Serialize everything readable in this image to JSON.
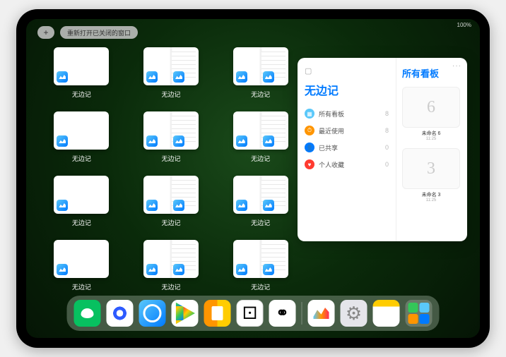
{
  "status": {
    "text": "100%"
  },
  "topbar": {
    "plus": "+",
    "reopen_label": "重新打开已关闭的窗口"
  },
  "thumbs": [
    {
      "label": "无边记",
      "split": false
    },
    {
      "label": "无边记",
      "split": true
    },
    {
      "label": "无边记",
      "split": true
    },
    {
      "label": "无边记",
      "split": false
    },
    {
      "label": "无边记",
      "split": true
    },
    {
      "label": "无边记",
      "split": true
    },
    {
      "label": "无边记",
      "split": false
    },
    {
      "label": "无边记",
      "split": true
    },
    {
      "label": "无边记",
      "split": true
    },
    {
      "label": "无边记",
      "split": false
    },
    {
      "label": "无边记",
      "split": true
    },
    {
      "label": "无边记",
      "split": true
    }
  ],
  "panel": {
    "title": "无边记",
    "right_title": "所有看板",
    "more": "···",
    "items": [
      {
        "icon": "grid",
        "color": "#5ac8fa",
        "label": "所有看板",
        "count": "8"
      },
      {
        "icon": "clock",
        "color": "#ff9500",
        "label": "最近使用",
        "count": "8"
      },
      {
        "icon": "person",
        "color": "#007aff",
        "label": "已共享",
        "count": "0"
      },
      {
        "icon": "heart",
        "color": "#ff3b30",
        "label": "个人收藏",
        "count": "0"
      }
    ],
    "boards": [
      {
        "glyph": "6",
        "name": "未命名 6",
        "time": "11:25"
      },
      {
        "glyph": "3",
        "name": "未命名 3",
        "time": "11:25"
      }
    ]
  },
  "dock": {
    "apps": [
      "wechat",
      "quark",
      "qq",
      "play",
      "books",
      "dice",
      "hub"
    ],
    "recent": [
      "freeform",
      "settings",
      "notes"
    ],
    "folder_colors": [
      "#34c759",
      "#5ac8fa",
      "#ff9500",
      "#007aff"
    ]
  }
}
